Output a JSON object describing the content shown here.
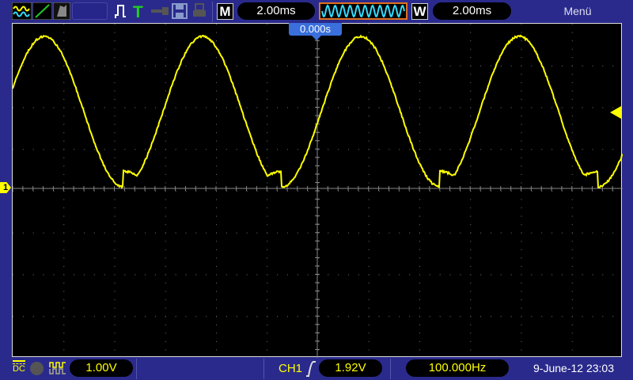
{
  "toolbar": {
    "icons": [
      "channel-waveform-icon",
      "math-line-icon",
      "reference-waveform-icon",
      "pulse-icon",
      "trigger-t-icon",
      "key-icon",
      "save-disk-icon",
      "printer-icon"
    ],
    "m_label": "M",
    "main_timebase": "2.00ms",
    "w_label": "W",
    "window_timebase": "2.00ms",
    "menu_label": "Menü"
  },
  "screen": {
    "trigger_position": "0.000s",
    "channel_marker": "1"
  },
  "status": {
    "coupling": "DC",
    "ch1_scale": "1.00V",
    "trigger_source": "CH1",
    "trigger_level": "1.92V",
    "frequency": "100.000Hz",
    "datetime": "9-June-12 23:03"
  },
  "colors": {
    "ch1": "#ffff00",
    "background": "#2a2a8c",
    "accent": "#e07020",
    "cyan": "#33ddff"
  }
}
